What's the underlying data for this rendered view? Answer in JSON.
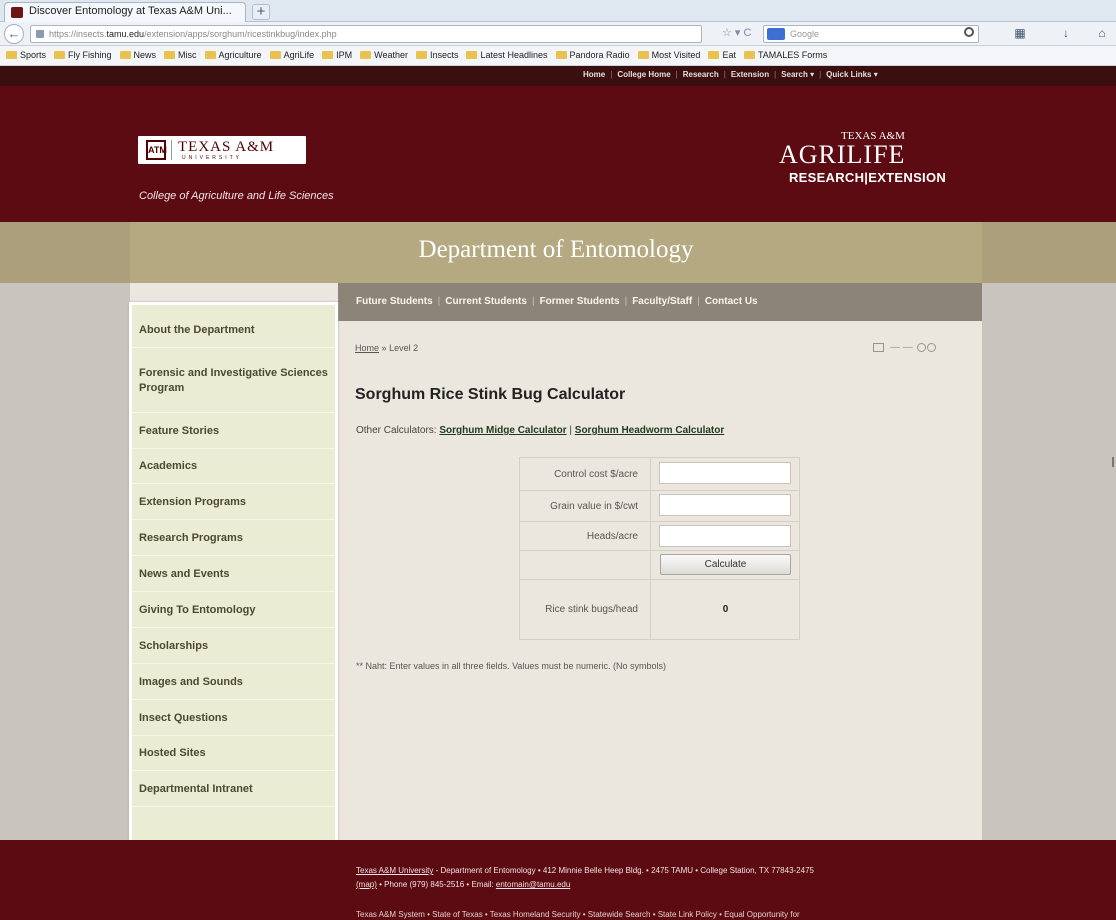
{
  "browser": {
    "tab_title": "Discover Entomology at Texas A&M Uni...",
    "new_tab": "+",
    "url_prefix": "https://insects.",
    "url_host": "tamu.edu",
    "url_path": "/extension/apps/sorghum/ricestinkbug/index.php",
    "search_placeholder": "Google",
    "bookmarks": [
      "Sports",
      "Fly Fishing",
      "News",
      "Misc",
      "Agriculture",
      "AgriLife",
      "IPM",
      "Weather",
      "Insects",
      "Latest Headlines",
      "Pandora Radio",
      "Most Visited",
      "Eat",
      "TAMALES Forms"
    ]
  },
  "utility_nav": [
    "Home",
    "College Home",
    "Research",
    "Extension",
    "Search ▾",
    "Quick Links ▾"
  ],
  "header": {
    "logo_box": "ATM",
    "logo_name": "TEXAS A&M",
    "logo_sub": "UNIVERSITY",
    "college": "College of Agriculture and Life Sciences",
    "agrilife_small": "TEXAS A&M",
    "agrilife_big": "AGRILIFE",
    "agrilife_line": "RESEARCH|EXTENSION"
  },
  "department_title": "Department of Entomology",
  "top_nav": [
    "Future Students",
    "Current Students",
    "Former Students",
    "Faculty/Staff",
    "Contact Us"
  ],
  "sidebar": [
    "About the Department",
    "Forensic and Investigative Sciences Program",
    "Feature Stories",
    "Academics",
    "Extension Programs",
    "Research Programs",
    "News and Events",
    "Giving To Entomology",
    "Scholarships",
    "Images and Sounds",
    "Insect Questions",
    "Hosted Sites",
    "Departmental Intranet"
  ],
  "breadcrumb": {
    "home": "Home",
    "sep": "»",
    "current": "Level 2"
  },
  "page_tools": "— —",
  "main": {
    "title": "Sorghum Rice Stink Bug Calculator",
    "other_label": "Other Calculators:",
    "other_links": [
      "Sorghum Midge Calculator",
      "Sorghum Headworm Calculator"
    ],
    "other_sep": "|",
    "fields": [
      {
        "label": "Control cost $/acre",
        "value": ""
      },
      {
        "label": "Grain value in $/cwt",
        "value": ""
      },
      {
        "label": "Heads/acre",
        "value": ""
      }
    ],
    "calculate_label": "Calculate",
    "result_label": "Rice stink bugs/head",
    "result_value": "0",
    "note": "** Naht: Enter values in all three fields. Values must be numeric. (No symbols)"
  },
  "footer": {
    "line1_link": "Texas A&M University",
    "line1_rest": " - Department of Entomology • 412 Minnie Belle Heep Bldg. • 2475 TAMU • College Station, TX 77843-2475",
    "line2_link": "(map)",
    "line2_mid": " • Phone (979) 845-2516 • Email: ",
    "line2_email": "entomain@tamu.edu",
    "line3": "Texas A&M System • State of Texas • Texas Homeland Security • Statewide Search • State Link Policy • Equal Opportunity for"
  }
}
